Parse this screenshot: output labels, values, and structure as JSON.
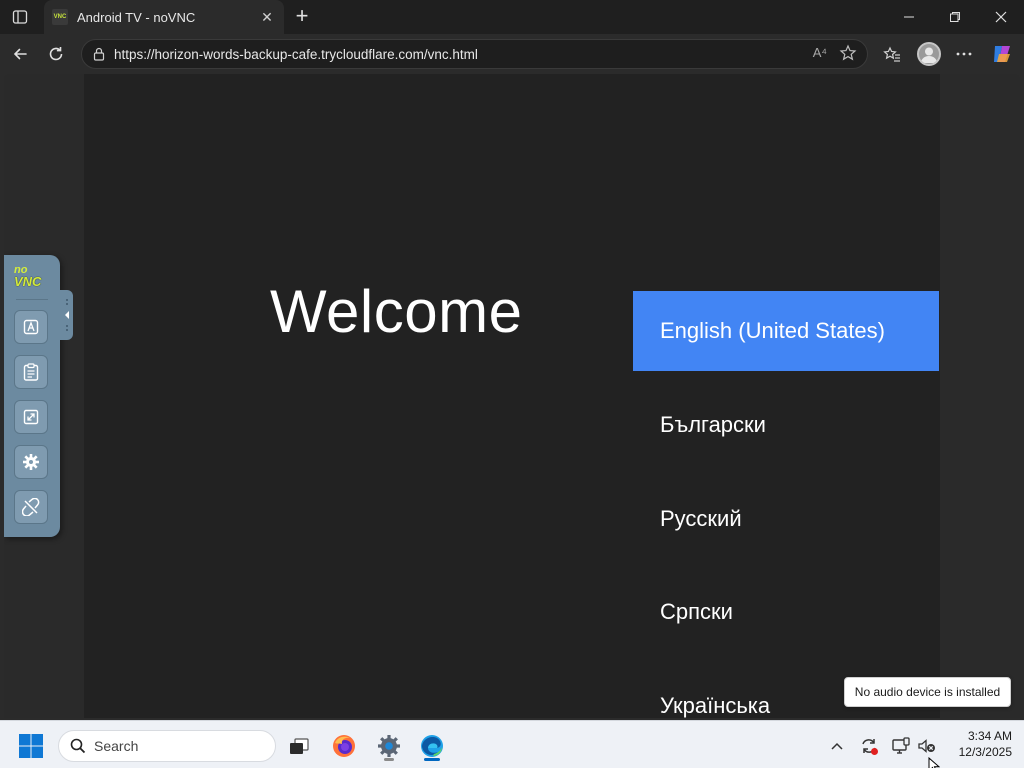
{
  "browser": {
    "tab_title": "Android TV - noVNC",
    "favicon_label": "VNC",
    "new_tab_label": "+",
    "url": "https://horizon-words-backup-cafe.trycloudflare.com/vnc.html",
    "read_aloud_label": "A⁴"
  },
  "tv": {
    "welcome_title": "Welcome",
    "languages": [
      {
        "label": "English (United States)",
        "selected": true
      },
      {
        "label": "Български",
        "selected": false
      },
      {
        "label": "Русский",
        "selected": false
      },
      {
        "label": "Српски",
        "selected": false
      },
      {
        "label": "Українська",
        "selected": false
      }
    ]
  },
  "novnc": {
    "logo_top": "no",
    "logo_bottom": "VNC",
    "buttons": [
      "extra-keys",
      "clipboard",
      "fullscreen",
      "settings",
      "disconnect"
    ]
  },
  "tooltip": {
    "text": "No audio device is installed"
  },
  "taskbar": {
    "search_placeholder": "Search",
    "clock_time": "3:34 AM",
    "clock_date": "12/3/2025",
    "apps": [
      "task-view",
      "firefox",
      "settings",
      "edge"
    ]
  },
  "colors": {
    "accent_selected": "#4285f4",
    "novnc_panel": "#6c8aa0",
    "tv_background": "#222222"
  }
}
